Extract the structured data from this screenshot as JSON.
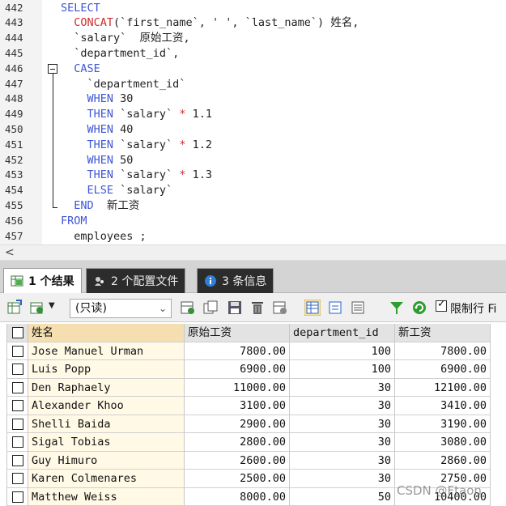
{
  "editor": {
    "lines": [
      {
        "n": "442",
        "code": [
          {
            "t": "SELECT",
            "c": "kw"
          }
        ]
      },
      {
        "n": "443",
        "code": [
          {
            "t": "  "
          },
          {
            "t": "CONCAT",
            "c": "fn"
          },
          {
            "t": "(`first_name`, ' ', `last_name`) 姓名,"
          }
        ]
      },
      {
        "n": "444",
        "code": [
          {
            "t": "  `salary`  原始工资,"
          }
        ]
      },
      {
        "n": "445",
        "code": [
          {
            "t": "  `department_id`,"
          }
        ]
      },
      {
        "n": "446",
        "code": [
          {
            "t": "  "
          },
          {
            "t": "CASE",
            "c": "kw"
          }
        ]
      },
      {
        "n": "447",
        "code": [
          {
            "t": "    `department_id`"
          }
        ]
      },
      {
        "n": "448",
        "code": [
          {
            "t": "    "
          },
          {
            "t": "WHEN",
            "c": "kw"
          },
          {
            "t": " 30"
          }
        ]
      },
      {
        "n": "449",
        "code": [
          {
            "t": "    "
          },
          {
            "t": "THEN",
            "c": "kw"
          },
          {
            "t": " `salary` "
          },
          {
            "t": "*",
            "c": "op"
          },
          {
            "t": " 1.1"
          }
        ]
      },
      {
        "n": "450",
        "code": [
          {
            "t": "    "
          },
          {
            "t": "WHEN",
            "c": "kw"
          },
          {
            "t": " 40"
          }
        ]
      },
      {
        "n": "451",
        "code": [
          {
            "t": "    "
          },
          {
            "t": "THEN",
            "c": "kw"
          },
          {
            "t": " `salary` "
          },
          {
            "t": "*",
            "c": "op"
          },
          {
            "t": " 1.2"
          }
        ]
      },
      {
        "n": "452",
        "code": [
          {
            "t": "    "
          },
          {
            "t": "WHEN",
            "c": "kw"
          },
          {
            "t": " 50"
          }
        ]
      },
      {
        "n": "453",
        "code": [
          {
            "t": "    "
          },
          {
            "t": "THEN",
            "c": "kw"
          },
          {
            "t": " `salary` "
          },
          {
            "t": "*",
            "c": "op"
          },
          {
            "t": " 1.3"
          }
        ]
      },
      {
        "n": "454",
        "code": [
          {
            "t": "    "
          },
          {
            "t": "ELSE",
            "c": "kw"
          },
          {
            "t": " `salary`"
          }
        ]
      },
      {
        "n": "455",
        "code": [
          {
            "t": "  "
          },
          {
            "t": "END",
            "c": "kw"
          },
          {
            "t": "  新工资"
          }
        ]
      },
      {
        "n": "456",
        "code": [
          {
            "t": "FROM",
            "c": "kw"
          }
        ]
      },
      {
        "n": "457",
        "code": [
          {
            "t": "  employees ;"
          }
        ]
      }
    ]
  },
  "scroll": {
    "left_arrow": "<"
  },
  "tabs": [
    {
      "label": "1 个结果",
      "icon": "result-grid-icon",
      "active": true
    },
    {
      "label": "2 个配置文件",
      "icon": "profile-icon",
      "active": false
    },
    {
      "label": "3 条信息",
      "icon": "info-icon",
      "active": false
    }
  ],
  "toolbar": {
    "mode_value": "(只读)",
    "limit_label": "限制行",
    "limit_checked": true,
    "truncated_text": "Fi"
  },
  "grid": {
    "columns": [
      "姓名",
      "原始工资",
      "department_id",
      "新工资"
    ],
    "rows": [
      [
        "Jose Manuel Urman",
        "7800.00",
        "100",
        "7800.00"
      ],
      [
        "Luis Popp",
        "6900.00",
        "100",
        "6900.00"
      ],
      [
        "Den Raphaely",
        "11000.00",
        "30",
        "12100.00"
      ],
      [
        "Alexander Khoo",
        "3100.00",
        "30",
        "3410.00"
      ],
      [
        "Shelli Baida",
        "2900.00",
        "30",
        "3190.00"
      ],
      [
        "Sigal Tobias",
        "2800.00",
        "30",
        "3080.00"
      ],
      [
        "Guy Himuro",
        "2600.00",
        "30",
        "2860.00"
      ],
      [
        "Karen Colmenares",
        "2500.00",
        "30",
        "2750.00"
      ],
      [
        "Matthew Weiss",
        "8000.00",
        "50",
        "10400.00"
      ]
    ]
  },
  "watermark": "CSDN @Ftaon",
  "colors": {
    "keyword": "#3d56d6",
    "function": "#d22c2c",
    "name_header": "#f5dfb0"
  }
}
